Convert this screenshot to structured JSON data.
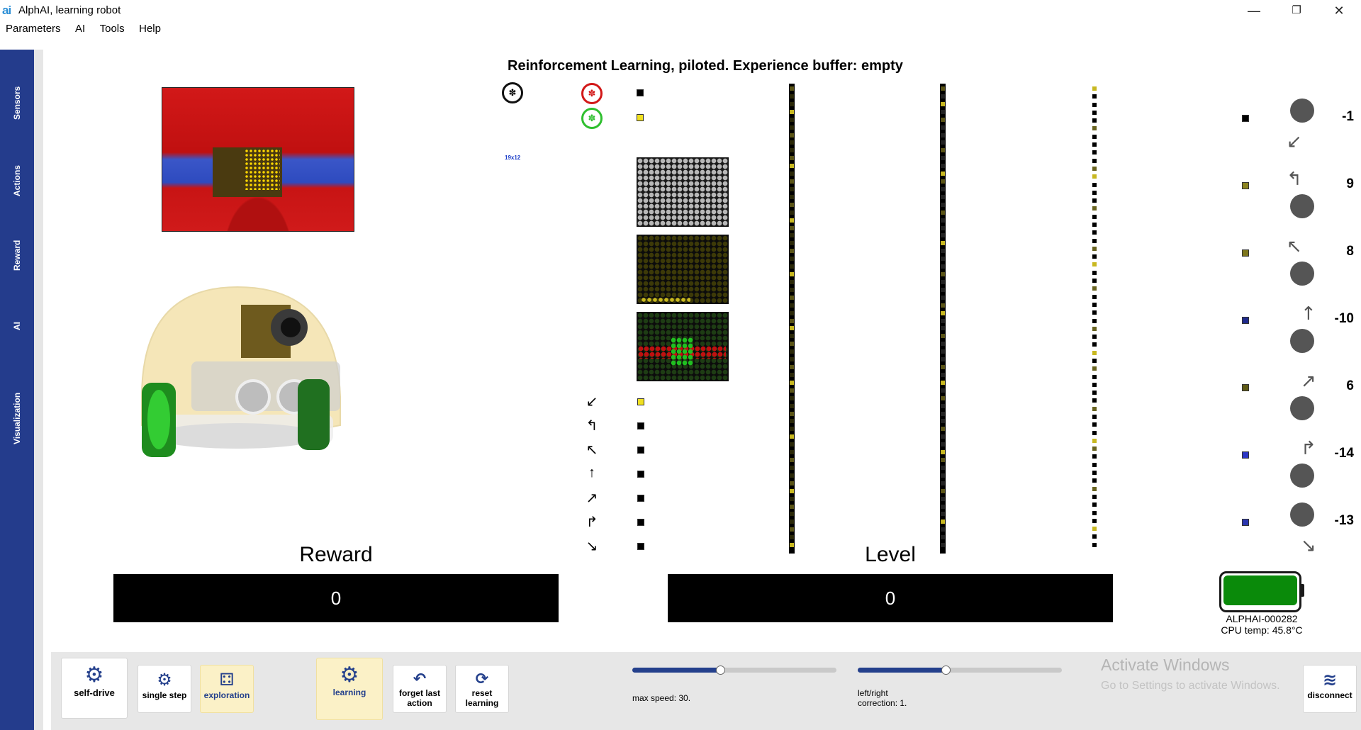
{
  "window": {
    "title": "AlphAI, learning robot",
    "logo": "ai"
  },
  "menu": [
    "Parameters",
    "AI",
    "Tools",
    "Help"
  ],
  "side_tabs": [
    "Sensors",
    "Actions",
    "Reward",
    "AI",
    "Visualization"
  ],
  "header": {
    "title": "Reinforcement Learning, piloted. Experience buffer: empty"
  },
  "sensors": {
    "camera_label": "19x12"
  },
  "actions": [
    {
      "icon": "turn-back-left-icon",
      "value": "-1",
      "input_color": "#000000",
      "output_color": "#000000"
    },
    {
      "icon": "turn-left-icon",
      "value": "9",
      "input_color": "#000000",
      "output_color": "#8d8520"
    },
    {
      "icon": "slight-left-icon",
      "value": "8",
      "input_color": "#000000",
      "output_color": "#7d761c"
    },
    {
      "icon": "forward-icon",
      "value": "-10",
      "input_color": "#000000",
      "output_color": "#1f2a8c"
    },
    {
      "icon": "slight-right-icon",
      "value": "6",
      "input_color": "#000000",
      "output_color": "#5f5a16"
    },
    {
      "icon": "turn-right-icon",
      "value": "-14",
      "input_color": "#000000",
      "output_color": "#2b36c4"
    },
    {
      "icon": "turn-back-right-icon",
      "value": "-13",
      "input_color": "#000000",
      "output_color": "#2b36b0"
    }
  ],
  "reward": {
    "label": "Reward",
    "value": "0"
  },
  "level": {
    "label": "Level",
    "value": "0"
  },
  "robot_status": {
    "id": "ALPHAI-000282",
    "cpu_temp": "CPU temp: 45.8°C",
    "battery_level": 1.0,
    "battery_color": "#0a8a0a"
  },
  "toolbar": {
    "self_drive": "self-drive",
    "single_step": "single step",
    "exploration": "exploration",
    "learning": "learning",
    "forget_last_action": "forget last action",
    "reset_learning": "reset learning",
    "disconnect": "disconnect"
  },
  "sliders": {
    "max_speed": {
      "label": "max speed: 30.",
      "value_fraction": 0.43
    },
    "correction": {
      "label": "left/right correction: 1.",
      "value_fraction": 0.43
    }
  },
  "watermark": {
    "line1": "Activate Windows",
    "line2": "Go to Settings to activate Windows."
  }
}
